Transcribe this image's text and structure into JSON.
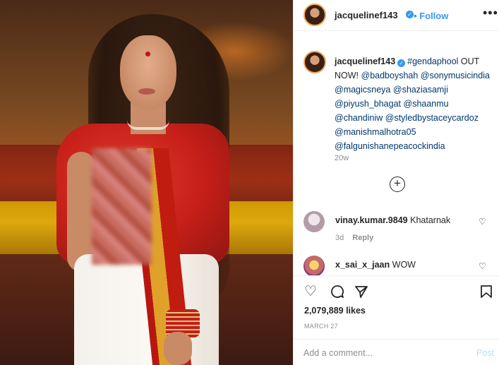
{
  "post": {
    "username": "jacquelinef143",
    "dot": "•",
    "follow_label": "Follow",
    "more_label": "•••",
    "verified_icon": "verified-badge-icon",
    "accent_color": "#3897f0"
  },
  "caption": {
    "username": "jacquelinef143",
    "hashtag": "#gendaphool",
    "text_part": " OUT NOW! ",
    "mentions": [
      "@badboyshah",
      "@sonymusicindia",
      "@magicsneya",
      "@shaziasamji",
      "@piyush_bhagat",
      "@shaanmu",
      "@chandiniw",
      "@styledbystaceycardoz",
      "@manishmalhotra05",
      "@falgunishanepeacockindia"
    ],
    "age": "20w"
  },
  "load_more_icon": "plus-circle-icon",
  "comments": [
    {
      "username": "vinay.kumar.9849",
      "text": "Khatarnak",
      "age": "3d",
      "reply_label": "Reply"
    },
    {
      "username": "x_sai_x_jaan",
      "text": "WOW"
    }
  ],
  "actions": {
    "icons": [
      "heart-icon",
      "comment-icon",
      "share-icon",
      "bookmark-icon"
    ],
    "likes": "2,079,889 likes",
    "date": "MARCH 27"
  },
  "add_comment": {
    "placeholder": "Add a comment...",
    "post_label": "Post"
  }
}
